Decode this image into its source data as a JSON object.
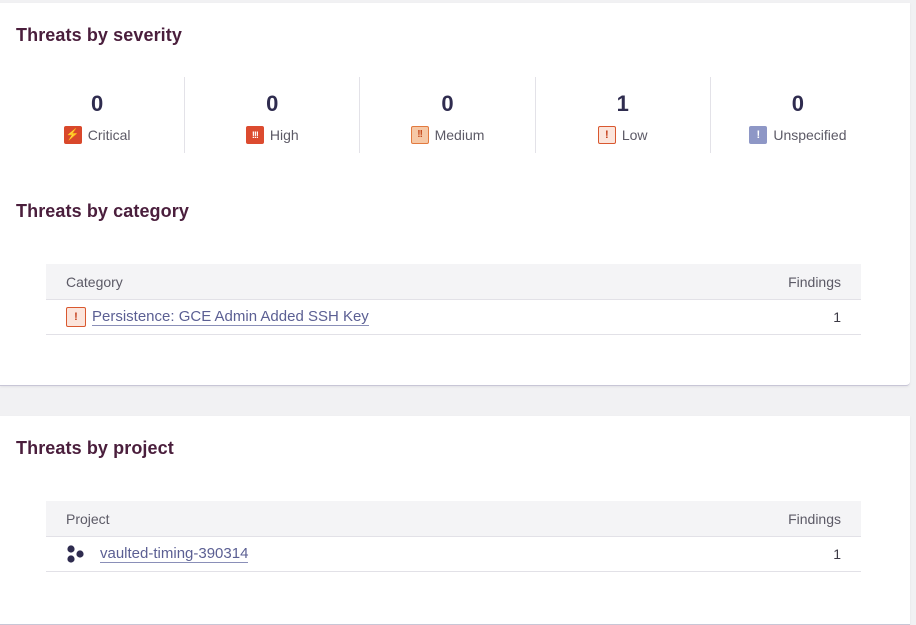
{
  "severity_section": {
    "title": "Threats by severity",
    "items": [
      {
        "label": "Critical",
        "count": "0",
        "icon": "bolt-icon",
        "glyph": "⚡",
        "color": "#d9482b"
      },
      {
        "label": "High",
        "count": "0",
        "icon": "triple-exclamation-icon",
        "glyph": "!!!",
        "color": "#dc4b2f"
      },
      {
        "label": "Medium",
        "count": "0",
        "icon": "double-exclamation-icon",
        "glyph": "!!",
        "color": "#e27a3f"
      },
      {
        "label": "Low",
        "count": "1",
        "icon": "exclamation-icon",
        "glyph": "!",
        "color": "#d9582f"
      },
      {
        "label": "Unspecified",
        "count": "0",
        "icon": "exclamation-icon",
        "glyph": "!",
        "color": "#8e97c6"
      }
    ]
  },
  "category_section": {
    "title": "Threats by category",
    "columns": [
      "Category",
      "Findings"
    ],
    "rows": [
      {
        "name": "Persistence: GCE Admin Added SSH Key",
        "findings": "1",
        "badge_glyph": "!"
      }
    ]
  },
  "project_section": {
    "title": "Threats by project",
    "columns": [
      "Project",
      "Findings"
    ],
    "rows": [
      {
        "name": "vaulted-timing-390314",
        "findings": "1"
      }
    ]
  }
}
